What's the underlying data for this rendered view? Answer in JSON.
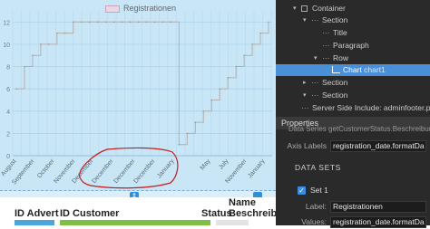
{
  "chart_data": {
    "type": "line",
    "legend": [
      "Registrationen"
    ],
    "series": [
      {
        "name": "Registrationen",
        "color": "#b0b0b0",
        "values": [
          6,
          8,
          9,
          10,
          10,
          11,
          11,
          12,
          12,
          12,
          12,
          12,
          12,
          12,
          12,
          12,
          12,
          12,
          12,
          12,
          1,
          2,
          3,
          4,
          5,
          6,
          7,
          8,
          9,
          10,
          11,
          12
        ]
      }
    ],
    "x_ticks": [
      "August",
      "September",
      "October",
      "November",
      "December",
      "December",
      "December",
      "December",
      "January",
      "May",
      "July",
      "November",
      "January"
    ],
    "y_ticks": [
      "0",
      "2",
      "4",
      "6",
      "8",
      "10",
      "12"
    ],
    "ylim": [
      0,
      13
    ]
  },
  "table": {
    "headers": {
      "id_advert": "ID Advert",
      "id_customer": "ID Customer",
      "status": "Status",
      "name_1": "Name",
      "name_2": "Beschreibung"
    }
  },
  "panel": {
    "tree": [
      {
        "label": "Container",
        "type": "box"
      },
      {
        "label": "Section",
        "type": "dash"
      },
      {
        "label": "Title",
        "type": "dash"
      },
      {
        "label": "Paragraph",
        "type": "dash"
      },
      {
        "label": "Row",
        "type": "dash"
      },
      {
        "label": "Chart",
        "hint": "chart1",
        "type": "chart"
      },
      {
        "label": "Section",
        "type": "dash"
      },
      {
        "label": "Section",
        "type": "dash"
      },
      {
        "label": "Server Side Include: ",
        "hint": "adminfooter.php",
        "type": "dash"
      }
    ],
    "properties_title": "Properties",
    "cut_text": "Data Series   getCustomerStatus.Beschreibung",
    "axis_labels_label": "Axis Labels",
    "axis_labels_value": "registration_date.formatDa",
    "data_sets_title": "DATA SETS",
    "set_name": "Set 1",
    "label_label": "Label:",
    "label_value": "Registrationen",
    "values_label": "Values:",
    "values_value": "registration_date.formatDa"
  }
}
